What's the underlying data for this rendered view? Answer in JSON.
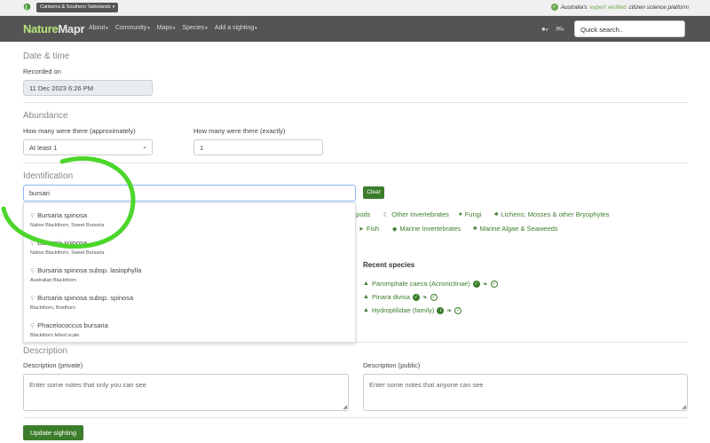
{
  "topbar": {
    "region": "Canberra & Southern Tablelands",
    "tagline_prefix": "Australia's",
    "tagline_highlight": "expert verified",
    "tagline_suffix": "citizen science platform"
  },
  "nav": {
    "logo_left": "Nature",
    "logo_right": "Mapr",
    "items": [
      "About",
      "Community",
      "Maps",
      "Species",
      "Add a sighting"
    ],
    "search_placeholder": "Quick search.."
  },
  "datetime": {
    "section": "Date & time",
    "label": "Recorded on",
    "value": "11 Dec 2023 6:26 PM"
  },
  "abundance": {
    "section": "Abundance",
    "approx_label": "How many were there (approximately)",
    "approx_value": "At least 1",
    "exact_label": "How many were there (exactly)",
    "exact_value": "1"
  },
  "identification": {
    "section": "Identification",
    "query": "bursari",
    "clear_label": "Clear",
    "categories": [
      "opods",
      "Other Invertebrates",
      "Fungi",
      "Lichens; Mosses & other Bryophytes",
      "Fish",
      "Marine Invertebrates",
      "Marine Algae & Seaweeds"
    ],
    "suggestions": [
      {
        "scientific": "Bursaria spinosa",
        "common": "Native Blackthorn, Sweet Bursaria"
      },
      {
        "scientific": "Bursaria spinosa",
        "common": "Native Blackthorn, Sweet Bursaria"
      },
      {
        "scientific": "Bursaria spinosa subsp. lasiophylla",
        "common": "Australian Blackthorn"
      },
      {
        "scientific": "Bursaria spinosa subsp. spinosa",
        "common": "Blackthorn, Boxthorn"
      },
      {
        "scientific": "Phacelococcus bursaria",
        "common": "Blackthorn felted scale"
      }
    ]
  },
  "recent_species": {
    "title": "Recent species",
    "items": [
      "Paromphale caeca (Acronictinae)",
      "Pinara divisa",
      "Hydroptilidae (family)"
    ]
  },
  "description": {
    "section": "Description",
    "private_label": "Description (private)",
    "private_placeholder": "Enter some notes that only you can see",
    "public_label": "Description (public)",
    "public_placeholder": "Enter some notes that anyone can see"
  },
  "submit_label": "Update sighting",
  "colors": {
    "accent": "#3c7d2c",
    "navbar": "#545454",
    "logo": "#b7e47a",
    "annotation": "#4cd62b"
  }
}
